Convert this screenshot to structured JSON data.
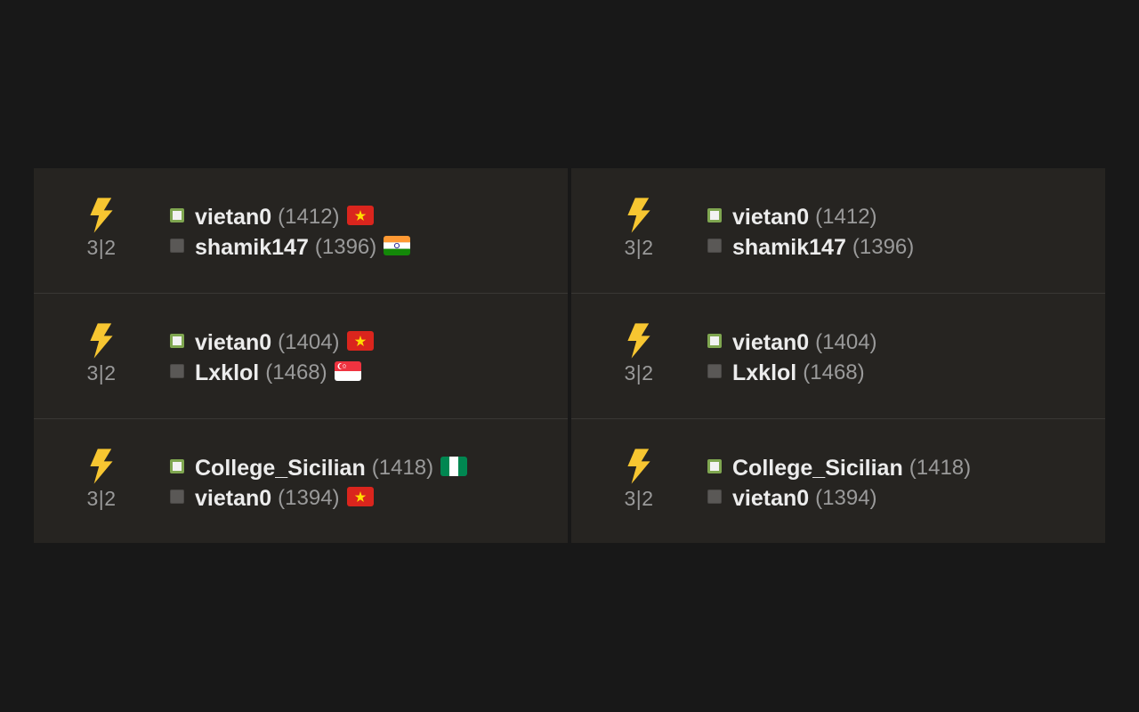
{
  "panels": [
    {
      "games": [
        {
          "speed_icon": "bolt-icon",
          "time_control": "3|2",
          "white": {
            "name": "vietan0",
            "rating": "(1412)",
            "flag": "vietnam-flag-icon"
          },
          "black": {
            "name": "shamik147",
            "rating": "(1396)",
            "flag": "india-flag-icon"
          }
        },
        {
          "speed_icon": "bolt-icon",
          "time_control": "3|2",
          "white": {
            "name": "vietan0",
            "rating": "(1404)",
            "flag": "vietnam-flag-icon"
          },
          "black": {
            "name": "Lxklol",
            "rating": "(1468)",
            "flag": "singapore-flag-icon"
          }
        },
        {
          "speed_icon": "bolt-icon",
          "time_control": "3|2",
          "white": {
            "name": "College_Sicilian",
            "rating": "(1418)",
            "flag": "nigeria-flag-icon"
          },
          "black": {
            "name": "vietan0",
            "rating": "(1394)",
            "flag": "vietnam-flag-icon"
          }
        }
      ]
    },
    {
      "games": [
        {
          "speed_icon": "bolt-icon",
          "time_control": "3|2",
          "white": {
            "name": "vietan0",
            "rating": "(1412)"
          },
          "black": {
            "name": "shamik147",
            "rating": "(1396)"
          }
        },
        {
          "speed_icon": "bolt-icon",
          "time_control": "3|2",
          "white": {
            "name": "vietan0",
            "rating": "(1404)"
          },
          "black": {
            "name": "Lxklol",
            "rating": "(1468)"
          }
        },
        {
          "speed_icon": "bolt-icon",
          "time_control": "3|2",
          "white": {
            "name": "College_Sicilian",
            "rating": "(1418)"
          },
          "black": {
            "name": "vietan0",
            "rating": "(1394)"
          }
        }
      ]
    }
  ],
  "colors": {
    "page_bg": "#181818",
    "panel_bg": "#262421",
    "bolt": "#f7c631",
    "white_square_border": "#7fa650",
    "name": "#ececec",
    "rating": "#9a9a9a"
  }
}
